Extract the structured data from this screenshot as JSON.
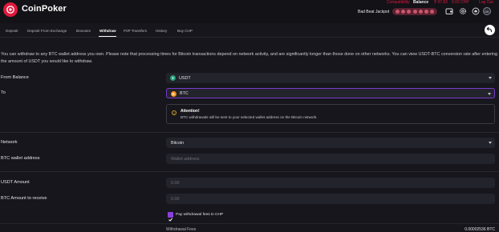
{
  "header": {
    "logo_text": "CoinPoker",
    "top_links": [
      "Compatibility",
      "Balance"
    ],
    "balance_values": [
      "₮ 97.83",
      "0.00 CHP"
    ],
    "logout_label": "Log Out",
    "jackpot_label": "Bad Beat Jackpot",
    "avatar_initials": "DK",
    "icons": [
      "wallet-icon",
      "settings-icon",
      "notifications-icon",
      "avatar"
    ],
    "colors": {
      "accent": "#e0193c",
      "background": "#16161c"
    }
  },
  "tabs": [
    "Deposit",
    "Deposit From Exchange",
    "Bonuses",
    "Withdraw",
    "P2P Transfers",
    "History",
    "Buy CHP"
  ],
  "active_tab": "Withdraw",
  "info_text": "You can withdraw to any BTC wallet address you own. Please note that processing times for Bitcoin transactions depend on network activity, and are significantly longer than those done on other networks. You can view USDT-BTC conversion rate after entering the amount of USDT you would like to withdraw.",
  "form": {
    "from_balance_label": "From Balance",
    "from_balance_value": "USDT",
    "to_label": "To",
    "to_value": "BTC",
    "alert_title": "Attention!",
    "alert_body": "BTC withdrawals will be sent to your selected wallet address on the Bitcoin network.",
    "network_label": "Network",
    "network_value": "Bitcoin",
    "wallet_label": "BTC wallet address",
    "wallet_placeholder": "Wallet address",
    "usdt_amount_label": "USDT Amount",
    "usdt_amount_placeholder": "0.00",
    "btc_receive_label": "BTC Amount to receive",
    "btc_receive_placeholder": "0.00",
    "pay_fees_label": "Pay withdrawal fees in CHP",
    "pay_fees_checked": true,
    "fee_label": "Withdrawal Fees",
    "fee_value": "0.00002536 BTC"
  },
  "coin_colors": {
    "usdt": "#26a17b",
    "btc": "#f7931a",
    "selected_border": "#7a3bd0"
  }
}
